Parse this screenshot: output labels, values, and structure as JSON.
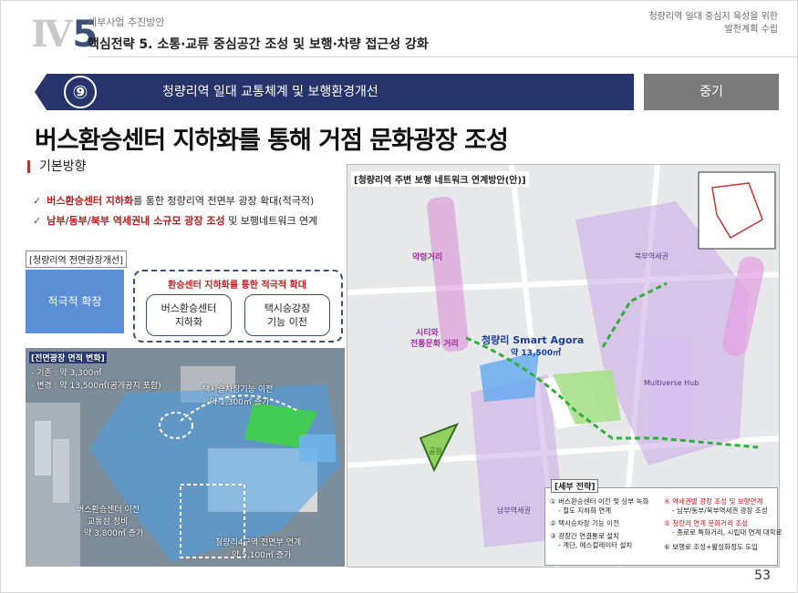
{
  "header": {
    "section_prefix": "Ⅳ",
    "section_number": "5",
    "section_label": "세부사업 추진방안",
    "strategy": "핵심전략 5. 소통·교류 중심공간 조성 및 보행·차량 접근성 강화",
    "right_line1": "청량리역 일대 중심지 육성을 위한",
    "right_line2": "발전계획 수립"
  },
  "ribbon": {
    "number": "⑨",
    "title": "청량리역 일대 교통체계 및 보행환경개선",
    "term": "중기"
  },
  "main_title": "버스환승센터 지하화를 통해 거점 문화광장 조성",
  "basic": {
    "heading": "기본방향",
    "bullet1_red": "버스환승센터 지하화",
    "bullet1_rest": "를 통한 청량리역 전면부 광장 확대(적극적)",
    "bullet2_red": "남부/동부/북부 역세권내 소규모 광장 조성",
    "bullet2_rest": " 및 보행네트워크 연계"
  },
  "plaza": {
    "label": "[청량리역 전면광장개선]",
    "expand": "적극적 확장",
    "dashed_title": "환승센터 지하화를 통한 적극적 확대",
    "card1_l1": "버스환승센터",
    "card1_l2": "지하화",
    "card2_l1": "택시승강장",
    "card2_l2": "기능 이전"
  },
  "aerial": {
    "title": "[전면광장 면적 변화]",
    "line1": "- 기존 : 약 3,300㎡",
    "line2": "- 변경 : 약 13,500㎡(공개공지 포함)",
    "taxi": "택시승차장기능 이전",
    "taxi_area": "약 1,300㎡ 증가",
    "bus": "버스환승센터 이전",
    "bus2": "교통섬 정비",
    "bus_area": "약 3,800㎡ 증가",
    "redev": "청량리4구역 전면부 연계",
    "redev_area": "약 5,100㎡ 증가"
  },
  "map": {
    "title": "[청량리역 주변 보행 네트워크 연계방안(안)]",
    "agora": "청량리 Smart Agora",
    "agora_area": "약 13,500㎡",
    "street1": "약령거리",
    "street2": "시티와",
    "street3": "전통문화 거리",
    "multiverse": "Multiverse Hub",
    "north": "북부역세권",
    "south": "남부역세권",
    "park": "공원"
  },
  "legend": {
    "title": "[세부 전략]",
    "i1": "① 버스환승센터 이전 및 상부 녹화",
    "i1s": "- 철도 지하화 연계",
    "i2": "② 택시승차장 기능 이전",
    "i3": "③ 광장간 연결통로 설치",
    "i3s": "- 계단, 에스컬레이터 설치",
    "i4": "④ 역세권별 광장 조성 및 보행연계",
    "i4s": "- 남부/동부/북부역세권 광장 조성",
    "i5": "⑤ 청량리 연계 문화거리 조성",
    "i5s": "- 종로로 특화거리, 시립대 연계 대학로",
    "i6": "⑥ 보행로 조성+활성화정도 도입"
  },
  "page_number": "53",
  "colors": {
    "navy": "#26346b",
    "gray": "#7a7a7a",
    "accent_red": "#b21f1f",
    "blue": "#5b8ed5"
  }
}
